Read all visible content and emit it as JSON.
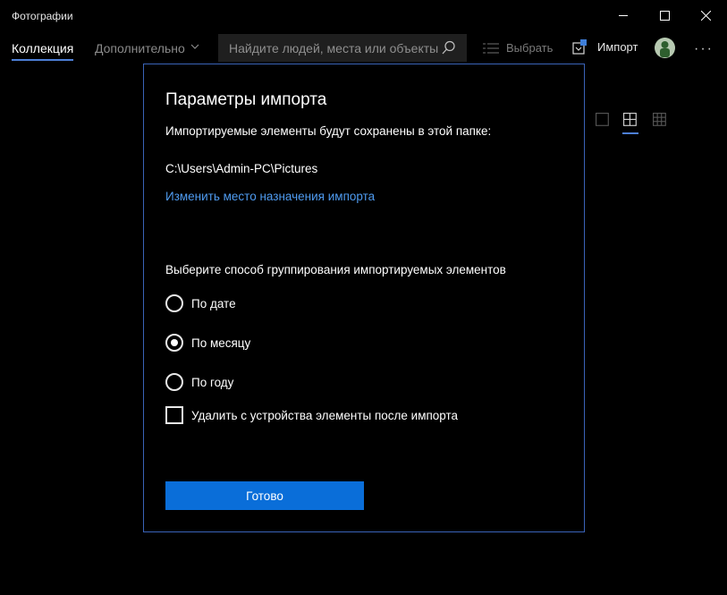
{
  "window": {
    "title": "Фотографии"
  },
  "nav": {
    "tabs": [
      {
        "label": "Коллекция",
        "active": true
      },
      {
        "label": "Дополнительно",
        "active": false
      }
    ],
    "search_placeholder": "Найдите людей, места или объекты",
    "select_label": "Выбрать",
    "import_label": "Импорт"
  },
  "dialog": {
    "title": "Параметры импорта",
    "folder_intro": "Импортируемые элементы будут сохранены в этой папке:",
    "folder_path": "C:\\Users\\Admin-PC\\Pictures",
    "change_link": "Изменить место назначения импорта",
    "group_prompt": "Выберите способ группирования импортируемых элементов",
    "group_options": [
      {
        "label": "По дате",
        "checked": false
      },
      {
        "label": "По месяцу",
        "checked": true
      },
      {
        "label": "По году",
        "checked": false
      }
    ],
    "delete_after_label": "Удалить с устройства элементы после импорта",
    "delete_after_checked": false,
    "done_label": "Готово"
  },
  "colors": {
    "accent": "#0a6ed9",
    "link": "#4f9bf0",
    "dialog_border": "#3a63b8"
  }
}
